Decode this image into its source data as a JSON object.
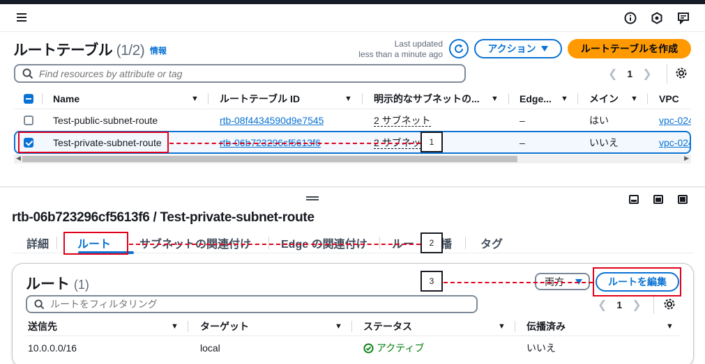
{
  "header": {
    "icons": [
      "menu-icon",
      "info-icon",
      "notifications-icon",
      "feedback-icon"
    ]
  },
  "route_tables": {
    "title": "ルートテーブル",
    "count": "(1/2)",
    "info_link": "情報",
    "last_updated_line1": "Last updated",
    "last_updated_line2": "less than a minute ago",
    "actions_label": "アクション",
    "create_label": "ルートテーブルを作成",
    "search_placeholder": "Find resources by attribute or tag",
    "page": "1",
    "columns": [
      "Name",
      "ルートテーブル ID",
      "明示的なサブネットの...",
      "Edge...",
      "メイン",
      "VPC"
    ],
    "rows": [
      {
        "name": "Test-public-subnet-route",
        "id": "rtb-08f4434590d9e7545",
        "subnets": "2 サブネット",
        "edge": "–",
        "main": "はい",
        "vpc": "vpc-024",
        "selected": false
      },
      {
        "name": "Test-private-subnet-route",
        "id": "rtb-06b723296cf5613f6",
        "subnets": "2 サブネッ",
        "edge": "–",
        "main": "いいえ",
        "vpc": "vpc-024",
        "selected": true
      }
    ]
  },
  "detail": {
    "title": "rtb-06b723296cf5613f6 / Test-private-subnet-route",
    "tabs": [
      "詳細",
      "ルート",
      "サブネットの関連付け",
      "Edge の関連付け",
      "ルー",
      "播",
      "タグ"
    ]
  },
  "routes": {
    "title": "ルート",
    "count": "(1)",
    "filter_value": "両方",
    "edit_label": "ルートを編集",
    "search_placeholder": "ルートをフィルタリング",
    "page": "1",
    "columns": [
      "送信先",
      "ターゲット",
      "ステータス",
      "伝播済み"
    ],
    "rows": [
      {
        "destination": "10.0.0.0/16",
        "target": "local",
        "status": "アクティブ",
        "propagated": "いいえ"
      }
    ]
  },
  "annotations": {
    "callouts": [
      "1",
      "2",
      "3"
    ],
    "color": "#e0001b"
  },
  "colors": {
    "accent": "#0972d3",
    "create_button": "#ff9900",
    "success": "#037f0c"
  }
}
